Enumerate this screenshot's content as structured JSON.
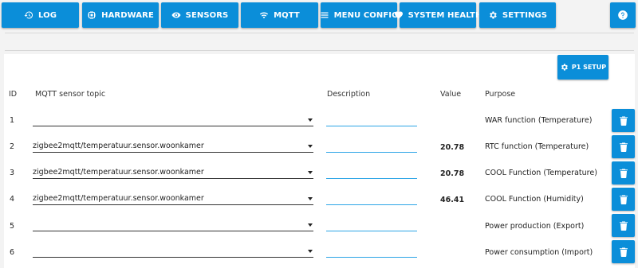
{
  "nav": {
    "log": {
      "label": "LOG",
      "icon": "history-icon"
    },
    "hardware": {
      "label": "HARDWARE",
      "icon": "chip-icon"
    },
    "sensors": {
      "label": "SENSORS",
      "icon": "eye-icon"
    },
    "mqtt": {
      "label": "MQTT",
      "icon": "wifi-icon"
    },
    "menu_config": {
      "label": "MENU CONFIG",
      "icon": "menu-icon"
    },
    "system_health": {
      "label": "SYSTEM HEALTH",
      "icon": "heart-icon"
    },
    "settings": {
      "label": "SETTINGS",
      "icon": "gear-icon"
    },
    "help": {
      "icon": "help-icon"
    }
  },
  "p1_setup": {
    "label": "P1 SETUP",
    "icon": "gear-icon"
  },
  "table": {
    "headers": {
      "id": "ID",
      "topic": "MQTT sensor topic",
      "description": "Description",
      "value": "Value",
      "purpose": "Purpose"
    },
    "rows": [
      {
        "id": "1",
        "topic": "",
        "description": "",
        "value": "",
        "purpose": "WAR function (Temperature)"
      },
      {
        "id": "2",
        "topic": "zigbee2mqtt/temperatuur.sensor.woonkamer",
        "description": "",
        "value": "20.78",
        "purpose": "RTC function (Temperature)"
      },
      {
        "id": "3",
        "topic": "zigbee2mqtt/temperatuur.sensor.woonkamer",
        "description": "",
        "value": "20.78",
        "purpose": "COOL Function (Temperature)"
      },
      {
        "id": "4",
        "topic": "zigbee2mqtt/temperatuur.sensor.woonkamer",
        "description": "",
        "value": "46.41",
        "purpose": "COOL Function (Humidity)"
      },
      {
        "id": "5",
        "topic": "",
        "description": "",
        "value": "",
        "purpose": "Power production (Export)"
      },
      {
        "id": "6",
        "topic": "",
        "description": "",
        "value": "",
        "purpose": "Power consumption (Import)"
      }
    ]
  },
  "colors": {
    "accent": "#0b8ed9",
    "input_underline": "#2ba4e6",
    "background": "#f3f3f3",
    "panel": "#ffffff"
  }
}
